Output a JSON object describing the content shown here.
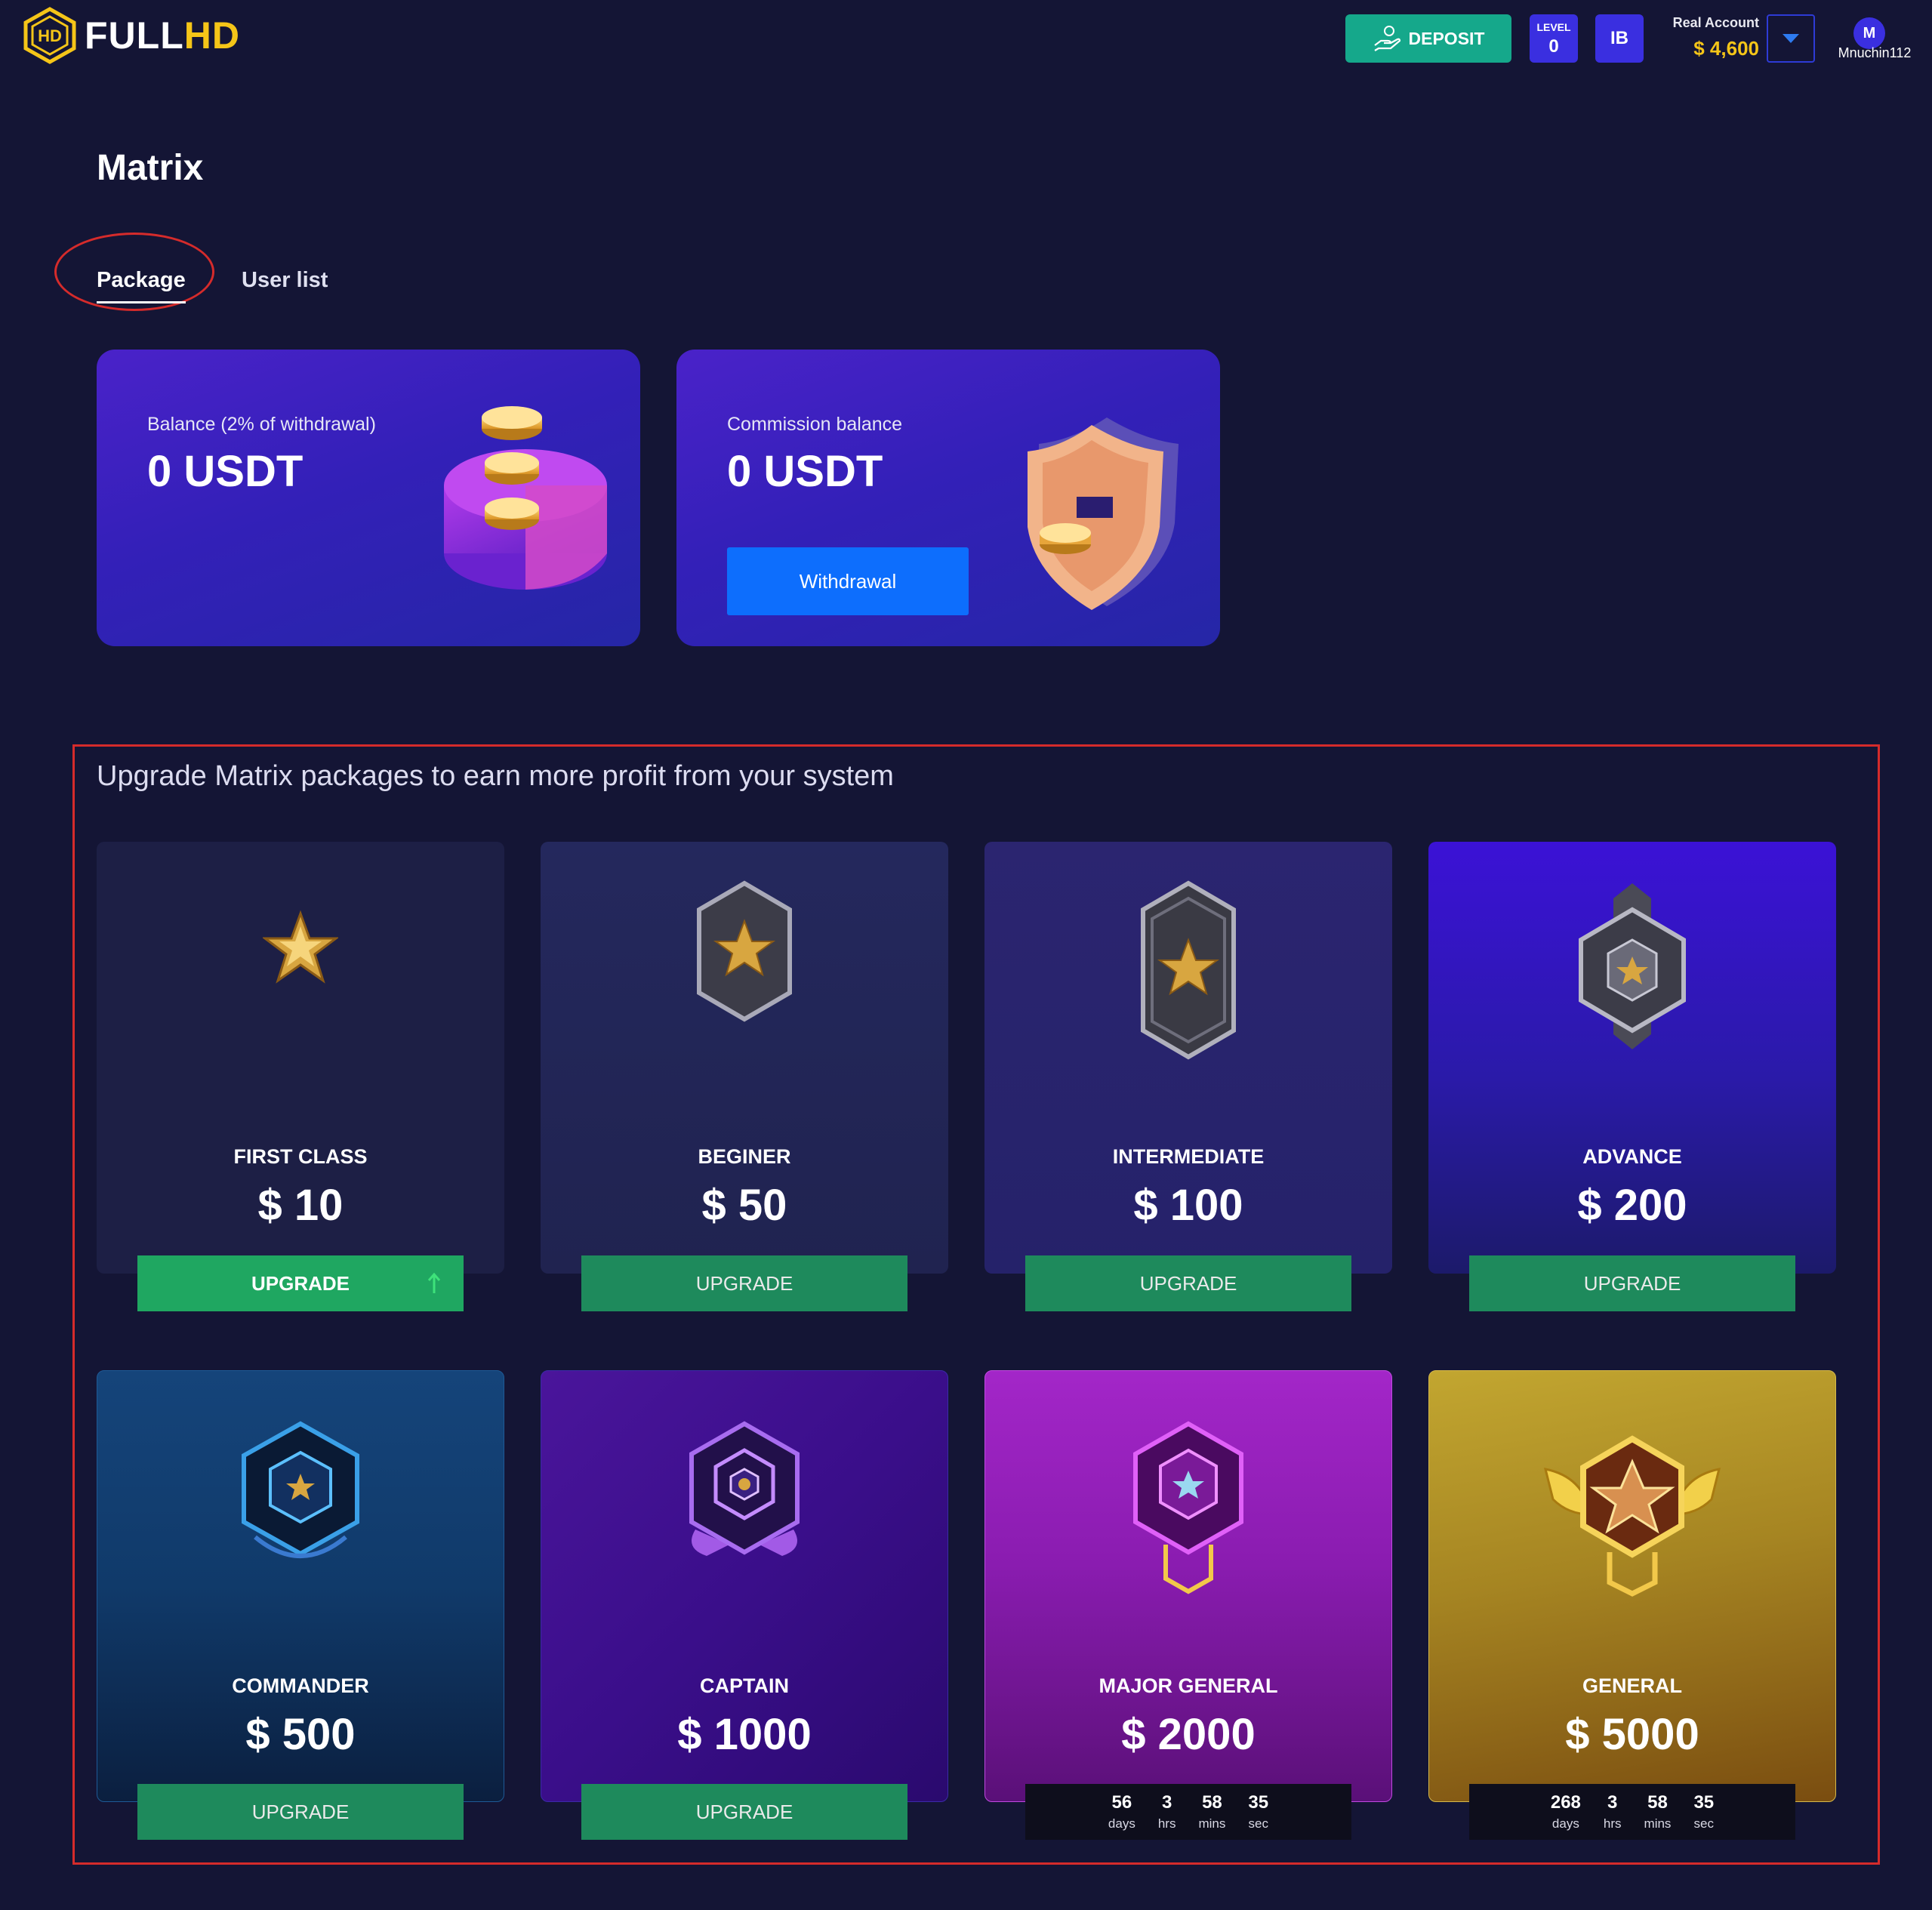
{
  "brand": {
    "full": "FULL",
    "hd": "HD"
  },
  "header": {
    "deposit_label": "DEPOSIT",
    "level_label": "LEVEL",
    "level_value": "0",
    "ib_label": "IB",
    "account_type": "Real Account",
    "account_balance": "$ 4,600",
    "avatar_initial": "M",
    "username": "Mnuchin112"
  },
  "page": {
    "title": "Matrix",
    "tabs": [
      {
        "label": "Package",
        "active": true
      },
      {
        "label": "User list",
        "active": false
      }
    ]
  },
  "balances": {
    "balance_label": "Balance (2% of withdrawal)",
    "balance_value": "0 USDT",
    "commission_label": "Commission balance",
    "commission_value": "0 USDT",
    "withdrawal_label": "Withdrawal"
  },
  "upgrade": {
    "heading": "Upgrade Matrix packages to earn more profit from your system",
    "packages": [
      {
        "name": "FIRST CLASS",
        "price": "$ 10",
        "button": "UPGRADE"
      },
      {
        "name": "BEGINER",
        "price": "$ 50",
        "button": "UPGRADE"
      },
      {
        "name": "INTERMEDIATE",
        "price": "$ 100",
        "button": "UPGRADE"
      },
      {
        "name": "ADVANCE",
        "price": "$ 200",
        "button": "UPGRADE"
      },
      {
        "name": "COMMANDER",
        "price": "$ 500",
        "button": "UPGRADE"
      },
      {
        "name": "CAPTAIN",
        "price": "$ 1000",
        "button": "UPGRADE"
      },
      {
        "name": "MAJOR GENERAL",
        "price": "$ 2000",
        "countdown": {
          "days": "56",
          "hrs": "3",
          "mins": "58",
          "sec": "35"
        }
      },
      {
        "name": "GENERAL",
        "price": "$ 5000",
        "countdown": {
          "days": "268",
          "hrs": "3",
          "mins": "58",
          "sec": "35"
        }
      }
    ],
    "countdown_units": {
      "days": "days",
      "hrs": "hrs",
      "mins": "mins",
      "sec": "sec"
    }
  },
  "colors": {
    "background": "#141535",
    "brand_yellow": "#f5c518",
    "deposit_green": "#15a88b",
    "upgrade_green": "#1e8a5c",
    "accent_blue": "#3a2fe0",
    "withdraw_blue": "#0d6efd",
    "highlight_red": "#d52b2b"
  },
  "icons": [
    "logo-icon",
    "deposit-hand-icon",
    "chevron-down-icon",
    "coin-stack-icon",
    "shield-coin-icon",
    "rank-badge-icon",
    "arrow-up-icon"
  ]
}
